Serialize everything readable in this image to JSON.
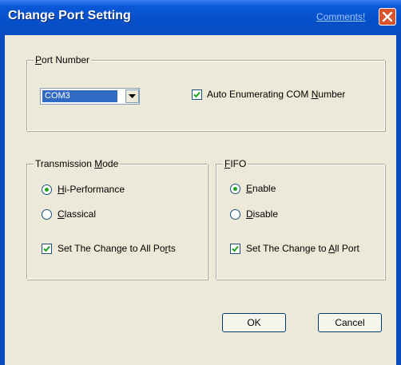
{
  "window": {
    "title": "Change Port Setting",
    "comments_link": "Comments!"
  },
  "port_number": {
    "legend_prefix": "",
    "legend_underlined": "P",
    "legend_suffix": "ort Number",
    "selected_port": "COM3",
    "auto_enum_checked": true,
    "auto_enum_prefix": "Auto Enumerating COM ",
    "auto_enum_underlined": "N",
    "auto_enum_suffix": "umber"
  },
  "transmission_mode": {
    "legend_prefix": "Transmission ",
    "legend_underlined": "M",
    "legend_suffix": "ode",
    "hi_perf_prefix": "",
    "hi_perf_underlined": "H",
    "hi_perf_suffix": "i-Performance",
    "classical_prefix": "",
    "classical_underlined": "C",
    "classical_suffix": "lassical",
    "selected": "Hi-Performance",
    "apply_all_checked": true,
    "apply_all_prefix": "Set The Change to All Po",
    "apply_all_underlined": "r",
    "apply_all_suffix": "ts"
  },
  "fifo": {
    "legend_prefix": "",
    "legend_underlined": "F",
    "legend_suffix": "IFO",
    "enable_prefix": "",
    "enable_underlined": "E",
    "enable_suffix": "nable",
    "disable_prefix": "",
    "disable_underlined": "D",
    "disable_suffix": "isable",
    "selected": "Enable",
    "apply_all_checked": true,
    "apply_all_prefix": "Set The Change to ",
    "apply_all_underlined": "A",
    "apply_all_suffix": "ll Port"
  },
  "buttons": {
    "ok": "OK",
    "cancel": "Cancel"
  },
  "colors": {
    "title_bar": "#0a4cc0",
    "dialog_bg": "#ece9d8",
    "close_button": "#d9532c",
    "selection": "#316ac5"
  }
}
